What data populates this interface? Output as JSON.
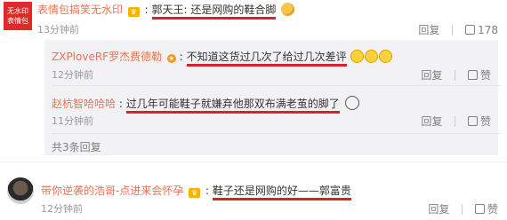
{
  "comments": [
    {
      "avatar_text_1": "无水印",
      "avatar_text_2": "表情包",
      "username": "表情包搞笑无水印",
      "text": "郭天王: 还是网购的鞋合脚",
      "time": "13分钟前",
      "reply_label": "回复",
      "like_count": "178"
    },
    {
      "avatar_caption": "Avatar",
      "username": "带你逆袭的浩哥-点进来会怀孕",
      "text": "鞋子还是网购的好——郭富贵",
      "time": "12分钟前",
      "reply_label": "回复",
      "like_label": "赞"
    }
  ],
  "replies": [
    {
      "username": "ZXPloveRF罗杰费德勒",
      "text": "不知道这货过几次了给过几次差评",
      "time": "12分钟前",
      "reply_label": "回复",
      "like_label": "赞"
    },
    {
      "username": "赵杭智哈哈哈",
      "text": "过几年可能鞋子就嫌弃他那双布满老茧的脚了",
      "time": "11分钟前",
      "reply_label": "回复",
      "like_label": "赞"
    }
  ],
  "more_replies": "共3条回复",
  "colors": {
    "accent": "#eb7350",
    "underline": "#d8232a",
    "reply_bg": "#f2f2f5"
  }
}
